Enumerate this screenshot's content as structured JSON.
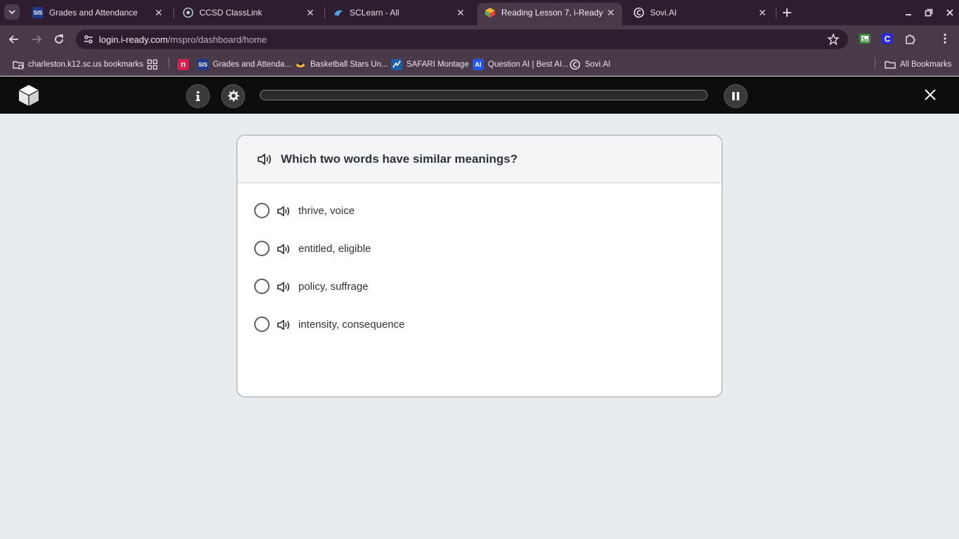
{
  "browser": {
    "tabs": [
      {
        "title": "Grades and Attendance",
        "favicon": "sis-icon",
        "active": false
      },
      {
        "title": "CCSD ClassLink",
        "favicon": "classlink-icon",
        "active": false
      },
      {
        "title": "SCLearn - All",
        "favicon": "sclearn-icon",
        "active": false
      },
      {
        "title": "Reading Lesson 7, i-Ready",
        "favicon": "iready-icon",
        "active": true
      },
      {
        "title": "Sovi.AI",
        "favicon": "sovi-icon",
        "active": false
      }
    ],
    "url_host": "login.i-ready.com",
    "url_path": "/mspro/dashboard/home",
    "bookmarks": [
      {
        "label": "charleston.k12.sc.us bookmarks",
        "icon": "folder-managed-icon"
      },
      {
        "label": "Grades and Attenda...",
        "icon": "sis-icon"
      },
      {
        "label": "Basketball Stars Un...",
        "icon": "basketball-icon"
      },
      {
        "label": "SAFARI Montage",
        "icon": "safari-montage-icon"
      },
      {
        "label": "Question AI | Best AI...",
        "icon": "question-ai-icon"
      },
      {
        "label": "Sovi.AI",
        "icon": "sovi-icon"
      }
    ],
    "all_bookmarks_label": "All Bookmarks"
  },
  "lesson": {
    "progress_fraction": 0.0,
    "question": "Which two words have similar meanings?",
    "choices": [
      {
        "label": "thrive, voice",
        "selected": false
      },
      {
        "label": "entitled, eligible",
        "selected": false
      },
      {
        "label": "policy, suffrage",
        "selected": false
      },
      {
        "label": "intensity, consequence",
        "selected": false
      }
    ]
  },
  "colors": {
    "chrome_dark": "#2d1d2e",
    "chrome_toolbar": "#4a3949",
    "app_header": "#0d0d0d",
    "page_bg": "#e8ecef"
  }
}
